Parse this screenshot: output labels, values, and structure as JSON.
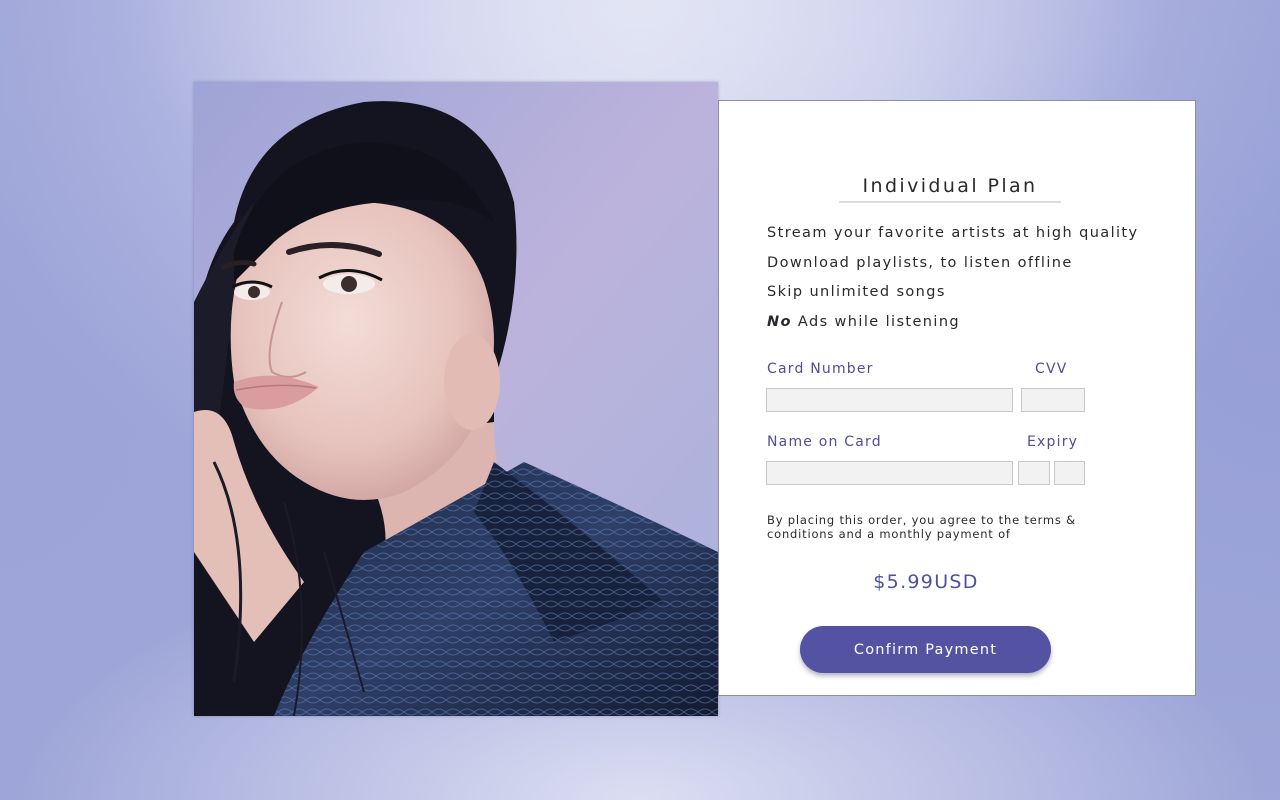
{
  "plan": {
    "title": "Individual Plan",
    "features": [
      "Stream your favorite artists at high quality",
      "Download playlists, to listen offline",
      "Skip unlimited songs"
    ],
    "no_ads_emphasis": "No",
    "no_ads_rest": " Ads while listening"
  },
  "form": {
    "card_number_label": "Card Number",
    "cvv_label": "CVV",
    "name_label": "Name on Card",
    "expiry_label": "Expiry",
    "card_number_value": "",
    "cvv_value": "",
    "name_value": "",
    "expiry_month_value": "",
    "expiry_year_value": ""
  },
  "terms": "By placing this order, you agree to the terms & conditions and a monthly payment of",
  "price": "$5.99USD",
  "confirm_label": "Confirm Payment",
  "colors": {
    "accent": "#5352a3",
    "label": "#4e4e9a",
    "background": "#a9b0dd"
  }
}
